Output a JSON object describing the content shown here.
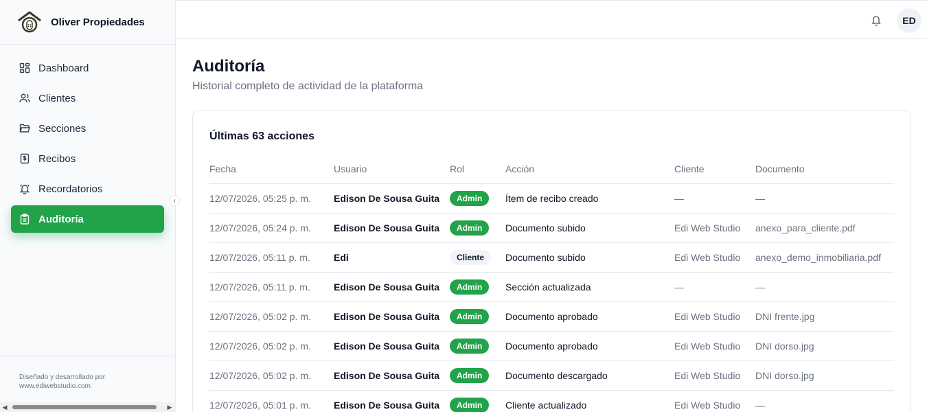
{
  "brand": {
    "name": "Oliver Propiedades"
  },
  "sidebar": {
    "items": [
      {
        "label": "Dashboard",
        "icon": "dashboard-icon",
        "active": false
      },
      {
        "label": "Clientes",
        "icon": "users-icon",
        "active": false
      },
      {
        "label": "Secciones",
        "icon": "folder-icon",
        "active": false
      },
      {
        "label": "Recibos",
        "icon": "receipt-icon",
        "active": false
      },
      {
        "label": "Recordatorios",
        "icon": "bell-icon",
        "active": false
      },
      {
        "label": "Auditoría",
        "icon": "clipboard-icon",
        "active": true
      }
    ],
    "footer_line1": "Diseñado y desarrollado por",
    "footer_line2": "www.ediwebstudio.com"
  },
  "topbar": {
    "avatar_initials": "ED"
  },
  "page": {
    "title": "Auditoría",
    "subtitle": "Historial completo de actividad de la plataforma"
  },
  "card": {
    "title": "Últimas 63 acciones",
    "columns": [
      "Fecha",
      "Usuario",
      "Rol",
      "Acción",
      "Cliente",
      "Documento"
    ],
    "rows": [
      {
        "fecha": "12/07/2026, 05:25 p. m.",
        "usuario": "Edison De Sousa Guita",
        "rol": "Admin",
        "accion": "Ítem de recibo creado",
        "cliente": "—",
        "documento": "—"
      },
      {
        "fecha": "12/07/2026, 05:24 p. m.",
        "usuario": "Edison De Sousa Guita",
        "rol": "Admin",
        "accion": "Documento subido",
        "cliente": "Edi Web Studio",
        "documento": "anexo_para_cliente.pdf"
      },
      {
        "fecha": "12/07/2026, 05:11 p. m.",
        "usuario": "Edi",
        "rol": "Cliente",
        "accion": "Documento subido",
        "cliente": "Edi Web Studio",
        "documento": "anexo_demo_inmobiliaria.pdf"
      },
      {
        "fecha": "12/07/2026, 05:11 p. m.",
        "usuario": "Edison De Sousa Guita",
        "rol": "Admin",
        "accion": "Sección actualizada",
        "cliente": "—",
        "documento": "—"
      },
      {
        "fecha": "12/07/2026, 05:02 p. m.",
        "usuario": "Edison De Sousa Guita",
        "rol": "Admin",
        "accion": "Documento aprobado",
        "cliente": "Edi Web Studio",
        "documento": "DNI frente.jpg"
      },
      {
        "fecha": "12/07/2026, 05:02 p. m.",
        "usuario": "Edison De Sousa Guita",
        "rol": "Admin",
        "accion": "Documento aprobado",
        "cliente": "Edi Web Studio",
        "documento": "DNI dorso.jpg"
      },
      {
        "fecha": "12/07/2026, 05:02 p. m.",
        "usuario": "Edison De Sousa Guita",
        "rol": "Admin",
        "accion": "Documento descargado",
        "cliente": "Edi Web Studio",
        "documento": "DNI dorso.jpg"
      },
      {
        "fecha": "12/07/2026, 05:01 p. m.",
        "usuario": "Edison De Sousa Guita",
        "rol": "Admin",
        "accion": "Cliente actualizado",
        "cliente": "Edi Web Studio",
        "documento": "—"
      }
    ]
  },
  "colors": {
    "accent": "#22a34a",
    "muted": "#6b7280",
    "border": "#e5e7eb"
  }
}
